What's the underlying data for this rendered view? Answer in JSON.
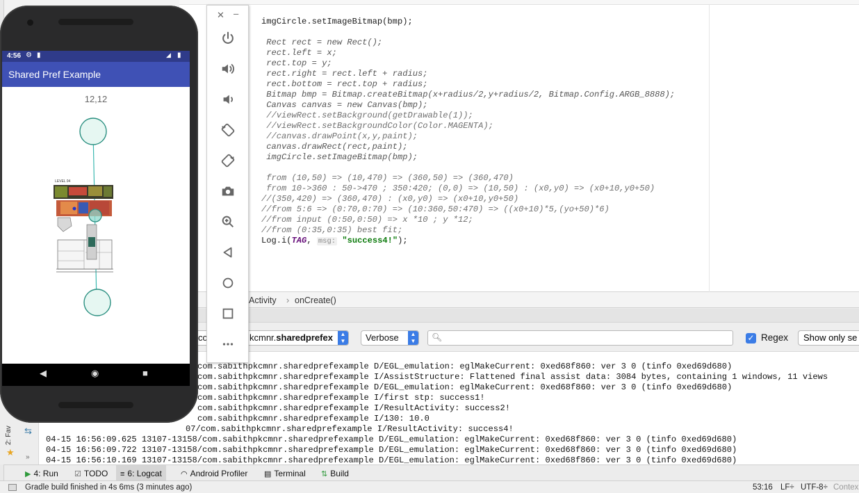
{
  "editor": {
    "lines": [
      {
        "text": "imgCircle.setImageBitmap(bmp);",
        "style": "plain"
      },
      {
        "text": "",
        "style": "plain"
      },
      {
        "text": " Rect rect = new Rect();",
        "style": "it"
      },
      {
        "text": " rect.left = x;",
        "style": "it"
      },
      {
        "text": " rect.top = y;",
        "style": "it"
      },
      {
        "text": " rect.right = rect.left + radius;",
        "style": "it"
      },
      {
        "text": " rect.bottom = rect.top + radius;",
        "style": "it"
      },
      {
        "text": " Bitmap bmp = Bitmap.createBitmap(x+radius/2,y+radius/2, Bitmap.Config.ARGB_8888);",
        "style": "it"
      },
      {
        "text": " Canvas canvas = new Canvas(bmp);",
        "style": "it"
      },
      {
        "text": " //viewRect.setBackground(getDrawable(1));",
        "style": "cm"
      },
      {
        "text": " //viewRect.setBackgroundColor(Color.MAGENTA);",
        "style": "cm"
      },
      {
        "text": " //canvas.drawPoint(x,y,paint);",
        "style": "cm"
      },
      {
        "text": " canvas.drawRect(rect,paint);",
        "style": "it"
      },
      {
        "text": " imgCircle.setImageBitmap(bmp);",
        "style": "it"
      },
      {
        "text": "",
        "style": "plain"
      },
      {
        "text": " from (10,50) => (10,470) => (360,50) => (360,470)",
        "style": "cm"
      },
      {
        "text": " from 10->360 : 50->470 ; 350:420; (0,0) => (10,50) : (x0,y0) => (x0+10,y0+50)",
        "style": "cm"
      },
      {
        "text": "//(350,420) => (360,470) : (x0,y0) => (x0+10,y0+50)",
        "style": "cm"
      },
      {
        "text": "//from 5:6 => (0:70,0:70) => (10:360,50:470) => ((x0+10)*5,(yo+50)*6)",
        "style": "cm"
      },
      {
        "text": "//from input (0:50,0:50) => x *10 ; y *12;",
        "style": "cm"
      },
      {
        "text": "//from (0:35,0:35) best fit;",
        "style": "cm"
      }
    ],
    "log_call": {
      "prefix": "Log.i(",
      "tag": "TAG",
      "hint": "msg:",
      "string": "\"success4!\"",
      "suffix": ");"
    }
  },
  "breadcrumb": {
    "class": "Activity",
    "separator": "›",
    "method": "onCreate()"
  },
  "logcat": {
    "package_prefix": "co",
    "package_rest": "kcmnr.",
    "package_bold": "sharedprefex",
    "level": "Verbose",
    "search_placeholder": "",
    "regex_label": "Regex",
    "regex_checked": true,
    "show_only": "Show only se",
    "lines": [
      "com.sabithpkcmnr.sharedprefexample D/EGL_emulation: eglMakeCurrent: 0xed68f860: ver 3 0 (tinfo 0xed69d680)",
      "com.sabithpkcmnr.sharedprefexample I/AssistStructure: Flattened final assist data: 3084 bytes, containing 1 windows, 11 views",
      "com.sabithpkcmnr.sharedprefexample D/EGL_emulation: eglMakeCurrent: 0xed68f860: ver 3 0 (tinfo 0xed69d680)",
      "com.sabithpkcmnr.sharedprefexample I/first stp: success1!",
      "com.sabithpkcmnr.sharedprefexample I/ResultActivity: success2!",
      "com.sabithpkcmnr.sharedprefexample I/130: 10.0",
      "07/com.sabithpkcmnr.sharedprefexample I/ResultActivity: success4!",
      "04-15 16:56:09.625 13107-13158/com.sabithpkcmnr.sharedprefexample D/EGL_emulation: eglMakeCurrent: 0xed68f860: ver 3 0 (tinfo 0xed69d680)",
      "04-15 16:56:09.722 13107-13158/com.sabithpkcmnr.sharedprefexample D/EGL_emulation: eglMakeCurrent: 0xed68f860: ver 3 0 (tinfo 0xed69d680)",
      "04-15 16:56:10.169 13107-13158/com.sabithpkcmnr.sharedprefexample D/EGL_emulation: eglMakeCurrent: 0xed68f860: ver 3 0 (tinfo 0xed69d680)"
    ]
  },
  "side": {
    "favorites_label": "2: Fav"
  },
  "tool_tabs": [
    {
      "label": "4: Run",
      "icon": "run-icon",
      "active": false
    },
    {
      "label": "TODO",
      "icon": "todo-icon",
      "active": false
    },
    {
      "label": "6: Logcat",
      "icon": "logcat-icon",
      "active": true
    },
    {
      "label": "Android Profiler",
      "icon": "profiler-icon",
      "active": false
    },
    {
      "label": "Terminal",
      "icon": "terminal-icon",
      "active": false
    },
    {
      "label": "Build",
      "icon": "build-icon",
      "active": false
    }
  ],
  "status_bar": {
    "message": "Gradle build finished in 4s 6ms (3 minutes ago)",
    "position": "53:16",
    "line_sep": "LF÷",
    "encoding": "UTF-8÷",
    "context": "Contex"
  },
  "emulator_toolbar": {
    "buttons": [
      "power-icon",
      "volume-up-icon",
      "volume-down-icon",
      "rotate-left-icon",
      "rotate-right-icon",
      "camera-icon",
      "zoom-icon",
      "back-icon",
      "home-icon",
      "overview-icon",
      "more-icon"
    ]
  },
  "phone": {
    "time": "4:56",
    "app_title": "Shared Pref Example",
    "coords_text": "12,12",
    "floorplan_label": "LEVEL 04",
    "colors": {
      "appbar": "#3f51b5",
      "statusbar": "#2f3b8a",
      "circle_fill": "#e6f7f2",
      "circle_stroke": "#2a8f80",
      "line": "#3bb8b0"
    }
  }
}
